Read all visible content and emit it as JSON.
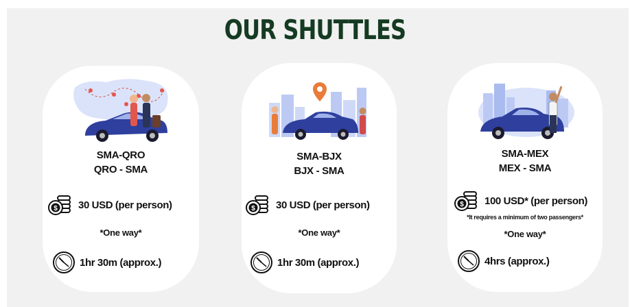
{
  "page": {
    "title": "OUR SHUTTLES"
  },
  "cards": [
    {
      "route_line1": "SMA-QRO",
      "route_line2": "QRO - SMA",
      "price": "30 USD (per person)",
      "note": "",
      "oneway": "*One way*",
      "duration": "1hr 30m (approx.)",
      "illustration": "couple-with-car-and-map-illustration"
    },
    {
      "route_line1": "SMA-BJX",
      "route_line2": "BJX - SMA",
      "price": "30 USD (per person)",
      "note": "",
      "oneway": "*One way*",
      "duration": "1hr 30m (approx.)",
      "illustration": "car-pickup-with-location-pin-illustration"
    },
    {
      "route_line1": "SMA-MEX",
      "route_line2": "MEX - SMA",
      "price": "100 USD* (per person)",
      "note": "*It requires a minimum of two passengers*",
      "oneway": "*One way*",
      "duration": "4hrs (approx.)",
      "illustration": "man-hailing-car-city-illustration"
    }
  ],
  "icons": {
    "price": "coins-icon",
    "duration": "clock-icon"
  },
  "colors": {
    "title": "#153b22",
    "background": "#f1f1f1",
    "car": "#2e3f9e"
  }
}
